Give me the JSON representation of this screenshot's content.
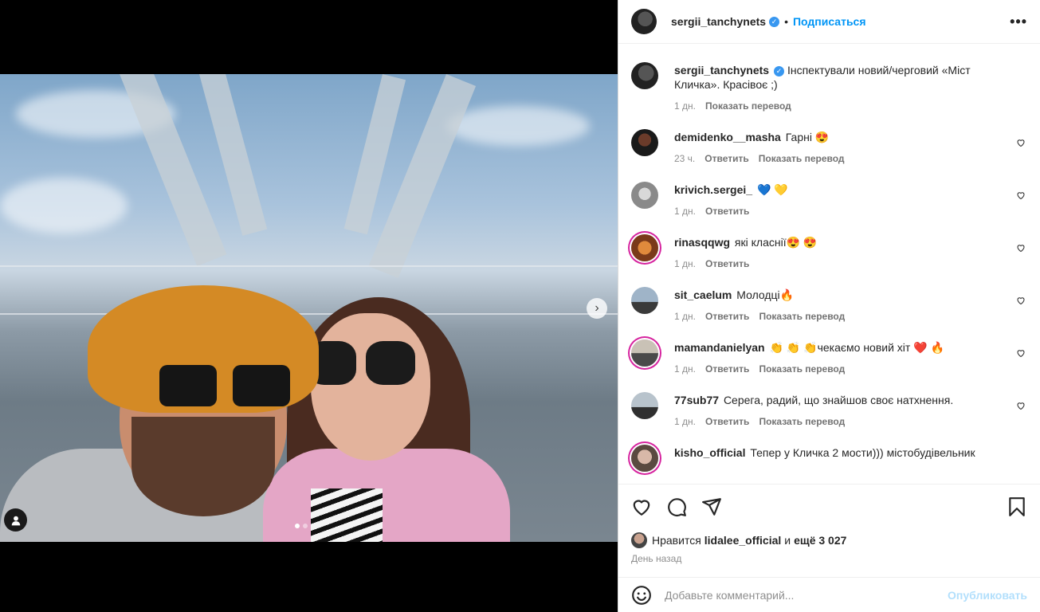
{
  "post": {
    "author": "sergii_tanchynets",
    "follow_label": "Подписаться",
    "separator": "•",
    "more_label": "•••",
    "caption": "Інспектували новий/черговий «Міст Кличка». Красівоє ;)",
    "caption_time": "1 дн.",
    "translate_label": "Показать перевод",
    "next_label": "›"
  },
  "comments": [
    {
      "user": "demidenko__masha",
      "text": "Гарні 😍",
      "time": "23 ч.",
      "reply": "Ответить",
      "translate": "Показать перевод"
    },
    {
      "user": "krivich.sergei_",
      "text": "💙 💛",
      "time": "1 дн.",
      "reply": "Ответить",
      "translate": ""
    },
    {
      "user": "rinasqqwg",
      "text": "які класнії😍 😍",
      "time": "1 дн.",
      "reply": "Ответить",
      "translate": ""
    },
    {
      "user": "sit_caelum",
      "text": "Молодці🔥",
      "time": "1 дн.",
      "reply": "Ответить",
      "translate": "Показать перевод"
    },
    {
      "user": "mamandanielyan",
      "text": "👏 👏 👏чекаємо новий хіт ❤️ 🔥",
      "time": "1 дн.",
      "reply": "Ответить",
      "translate": "Показать перевод"
    },
    {
      "user": "77sub77",
      "text": "Серега, радий, що знайшов своє натхнення.",
      "time": "1 дн.",
      "reply": "Ответить",
      "translate": "Показать перевод"
    },
    {
      "user": "kisho_official",
      "text": "Тепер у Кличка 2 мости))) містобудівельник",
      "time": "",
      "reply": "",
      "translate": ""
    }
  ],
  "likes": {
    "prefix": "Нравится",
    "user": "lidalee_official",
    "and": "и",
    "others": "ещё 3 027",
    "time": "День назад"
  },
  "composer": {
    "placeholder": "Добавьте комментарий...",
    "publish": "Опубликовать"
  },
  "colors": {
    "accent": "#0095f6",
    "verified": "#3897f0",
    "muted": "#8e8e8e"
  }
}
